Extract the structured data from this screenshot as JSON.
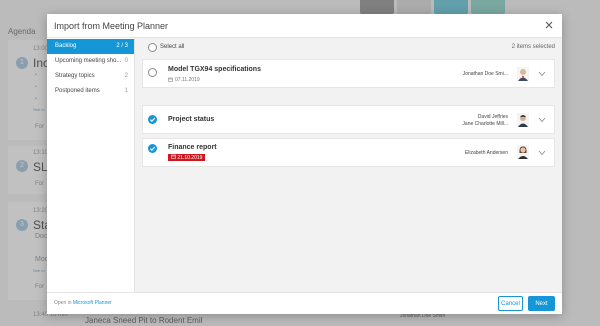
{
  "background": {
    "agenda_title": "Agenda",
    "items": [
      {
        "number": "1",
        "time": "13:00",
        "title": "Inc",
        "bullets": [
          "• ",
          "• ",
          "• "
        ],
        "link": "See m",
        "footer": "For"
      },
      {
        "number": "2",
        "time": "13:10",
        "title": "SLA",
        "footer": "For"
      },
      {
        "number": "3",
        "time": "13:20",
        "title": "Sta",
        "subtitle": "Doc",
        "extra": "Mod",
        "link": "See m",
        "footer": "For"
      }
    ],
    "bottom": {
      "time": "13:40 10 min",
      "text": "Janeca Sneed Pit to Rodent Emil",
      "person": "Jonathan Doe Smith"
    }
  },
  "dialog": {
    "title": "Import from Meeting Planner",
    "sidebar": [
      {
        "label": "Backlog",
        "count": "2 / 3",
        "active": true
      },
      {
        "label": "Upcoming meeting sho...",
        "count": "0"
      },
      {
        "label": "Strategy topics",
        "count": "2"
      },
      {
        "label": "Postponed items",
        "count": "1"
      }
    ],
    "select_all_label": "Select all",
    "items_selected": "2 items selected",
    "items": [
      {
        "title": "Model TGX94 specifications",
        "date": "07.11.2019",
        "overdue": false,
        "checked": false,
        "persons": [
          "Jonathan Doe Smi..."
        ]
      },
      {
        "title": "Project status",
        "date": "",
        "overdue": false,
        "checked": true,
        "persons": [
          "David Jeffries",
          "Jane Charlotte Mill..."
        ]
      },
      {
        "title": "Finance report",
        "date": "21.10.2019",
        "overdue": true,
        "checked": true,
        "persons": [
          "Elizabeth Andersen"
        ]
      }
    ],
    "footer": {
      "open_in_prefix": "Open in",
      "open_in_link": "Microsoft Planner",
      "cancel_label": "Cancel",
      "next_label": "Next"
    },
    "colors": {
      "accent": "#1596d6",
      "overdue": "#d0171f"
    }
  }
}
